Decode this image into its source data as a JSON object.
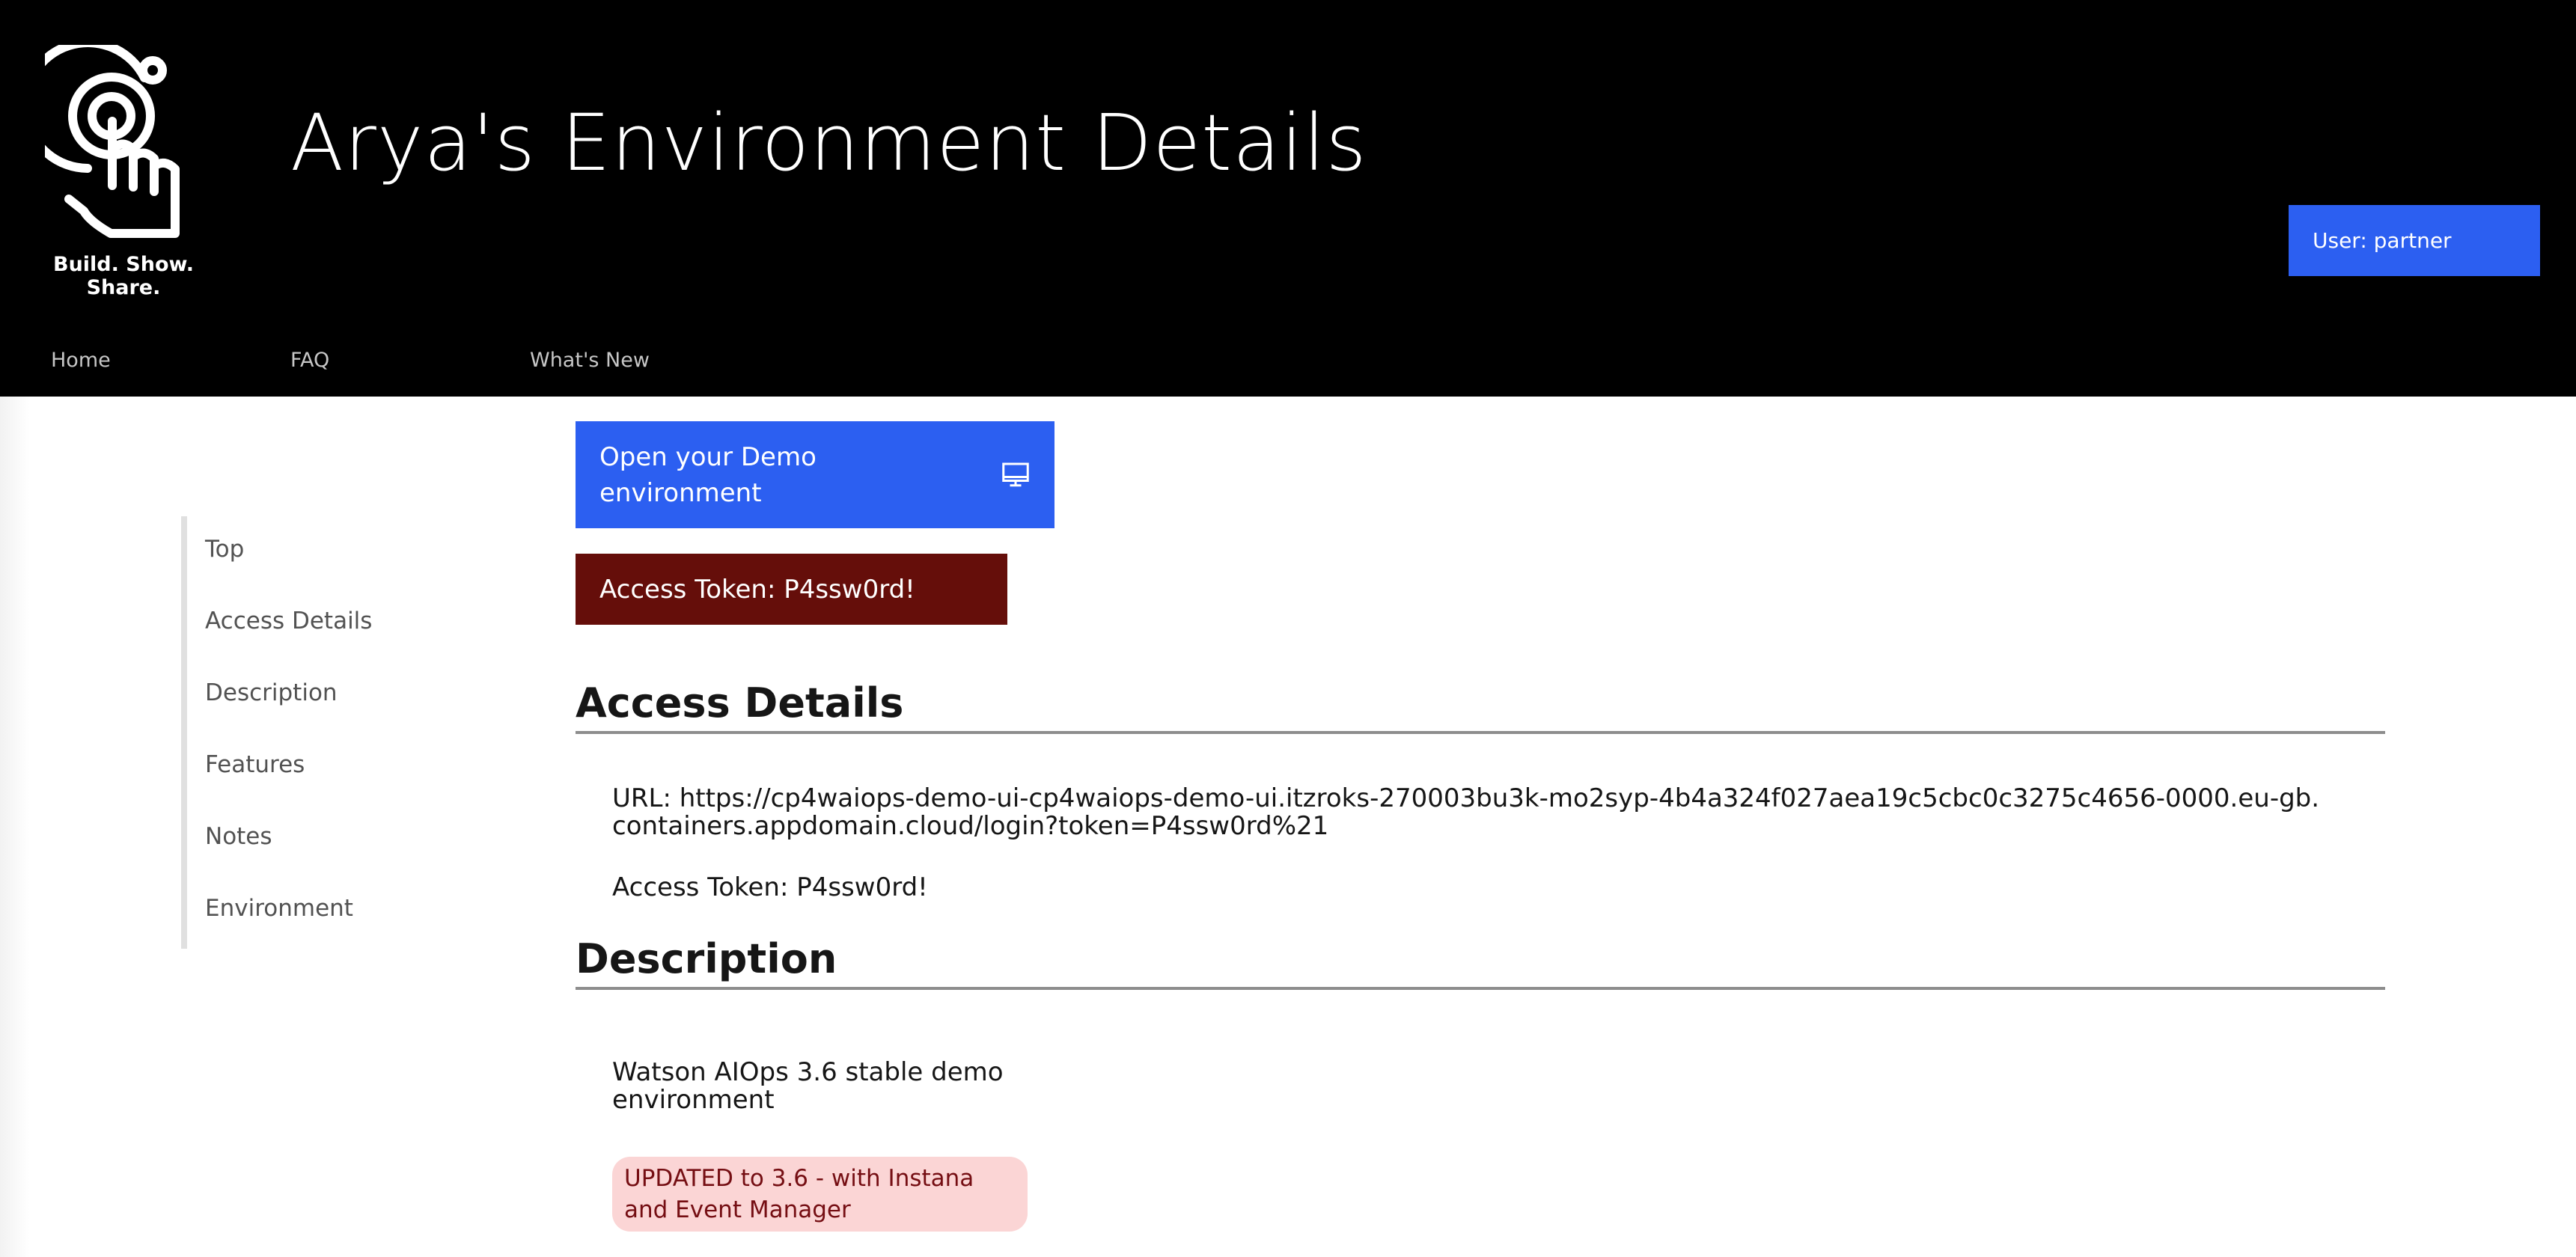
{
  "header": {
    "tagline": "Build. Show. Share.",
    "title": "Arya's Environment Details",
    "user_label": "User: partner",
    "logo_icon": "touch-target-logo-icon",
    "background_color": "#000000"
  },
  "topnav": {
    "items": [
      {
        "label": "Home"
      },
      {
        "label": "FAQ"
      },
      {
        "label": "What's New"
      }
    ]
  },
  "sidenav": {
    "items": [
      {
        "label": "Top"
      },
      {
        "label": "Access Details"
      },
      {
        "label": "Description"
      },
      {
        "label": "Features"
      },
      {
        "label": "Notes"
      },
      {
        "label": "Environment"
      }
    ]
  },
  "main": {
    "demo_button": {
      "label": "Open your Demo environment",
      "icon": "monitor-icon",
      "color": "#2c5ff1"
    },
    "token_banner": {
      "label": "Access Token: P4ssw0rd!",
      "color": "#650e0a"
    },
    "access_details": {
      "heading": "Access Details",
      "url": "URL: https://cp4waiops-demo-ui-cp4waiops-demo-ui.itzroks-270003bu3k-mo2syp-4b4a324f027aea19c5cbc0c3275c4656-0000.eu-gb.containers.appdomain.cloud/login?token=P4ssw0rd%21",
      "token": "Access Token: P4ssw0rd!"
    },
    "description": {
      "heading": "Description",
      "text": "Watson AIOps 3.6 stable demo environment",
      "tag": "UPDATED to 3.6 - with Instana and Event Manager",
      "tag_color": "#fbd5d5"
    }
  }
}
